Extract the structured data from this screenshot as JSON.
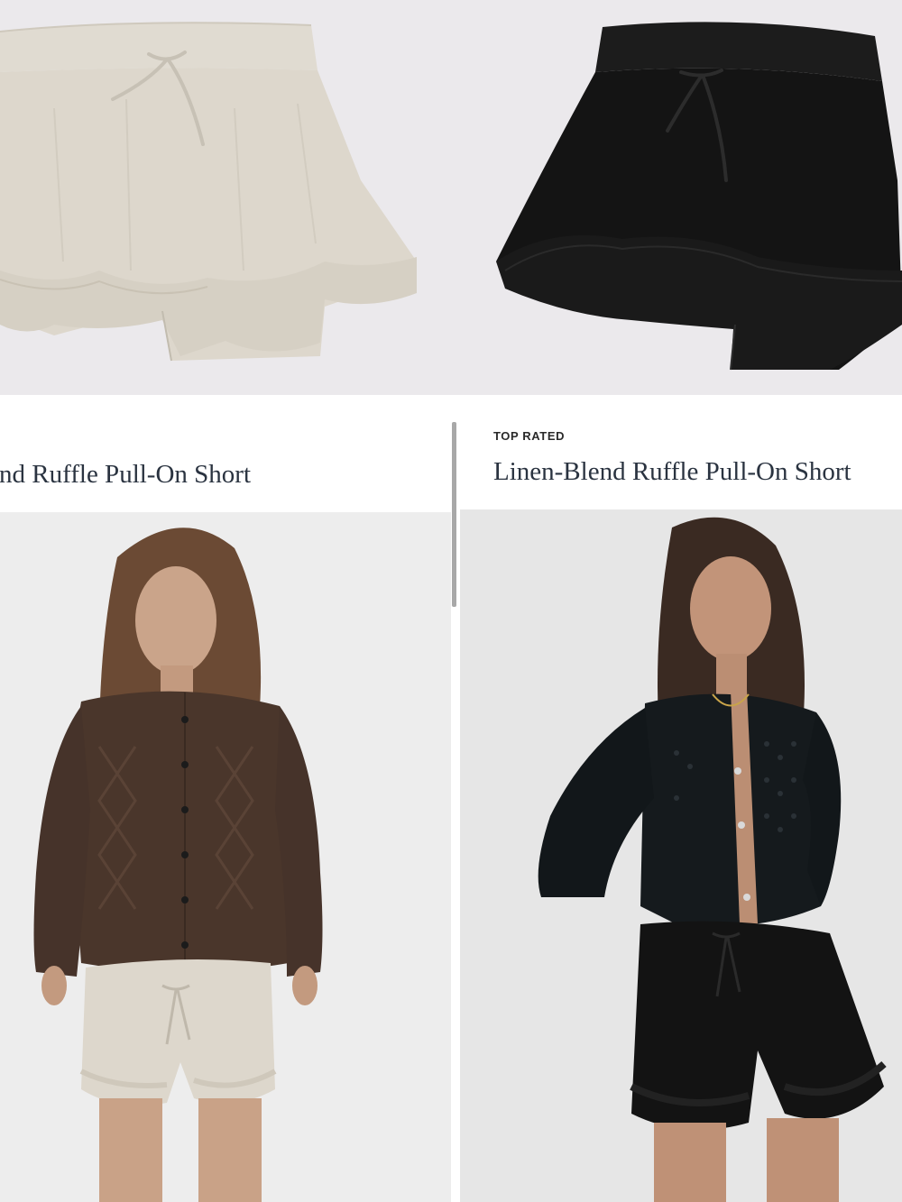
{
  "products": [
    {
      "title": "Linen-Blend Ruffle Pull-On Short",
      "visible_title": "nd Ruffle Pull-On Short",
      "badge": "",
      "flat_image": "oatmeal-ruffle-shorts-flat-lay",
      "model_image": "model-brown-cardigan-oatmeal-shorts"
    },
    {
      "title": "Linen-Blend Ruffle Pull-On Short",
      "visible_title": "Linen-Blend Ruffle Pull-On Short",
      "badge": "TOP RATED",
      "flat_image": "black-ruffle-shorts-flat-lay",
      "model_image": "model-black-cardigan-black-shorts"
    }
  ],
  "colors": {
    "oatmeal": "#dcd6cb",
    "black": "#141414",
    "brown_knit": "#4a362b",
    "title_text": "#2a3340"
  }
}
